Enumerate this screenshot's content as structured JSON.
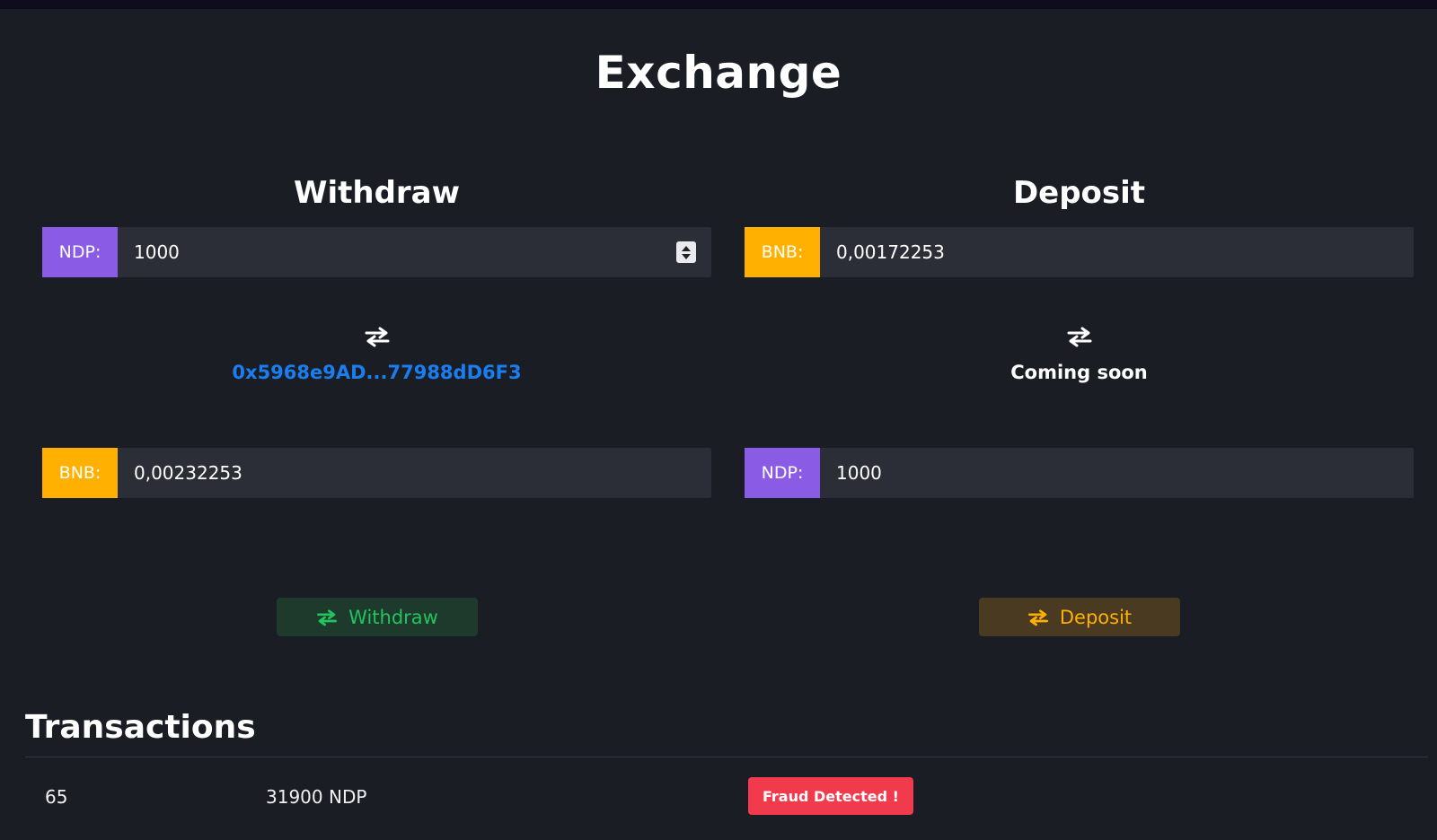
{
  "page": {
    "title": "Exchange"
  },
  "withdraw": {
    "title": "Withdraw",
    "from": {
      "tag": "NDP:",
      "value": "1000"
    },
    "address": "0x5968e9AD...77988dD6F3",
    "to": {
      "tag": "BNB:",
      "value": "0,00232253"
    },
    "button_label": "Withdraw"
  },
  "deposit": {
    "title": "Deposit",
    "from": {
      "tag": "BNB:",
      "value": "0,00172253"
    },
    "status": "Coming soon",
    "to": {
      "tag": "NDP:",
      "value": "1000"
    },
    "button_label": "Deposit"
  },
  "transactions": {
    "title": "Transactions",
    "rows": [
      {
        "id": "65",
        "amount": "31900 NDP",
        "status": "Fraud Detected !"
      }
    ]
  },
  "colors": {
    "ndp_tag": "#8a5ce6",
    "bnb_tag": "#ffb000",
    "link": "#1a7ef0",
    "withdraw_button": "#22c45e",
    "deposit_button": "#ffb000",
    "fraud_badge": "#f23a4d"
  },
  "icons": {
    "swap": "swap-arrows-icon"
  }
}
